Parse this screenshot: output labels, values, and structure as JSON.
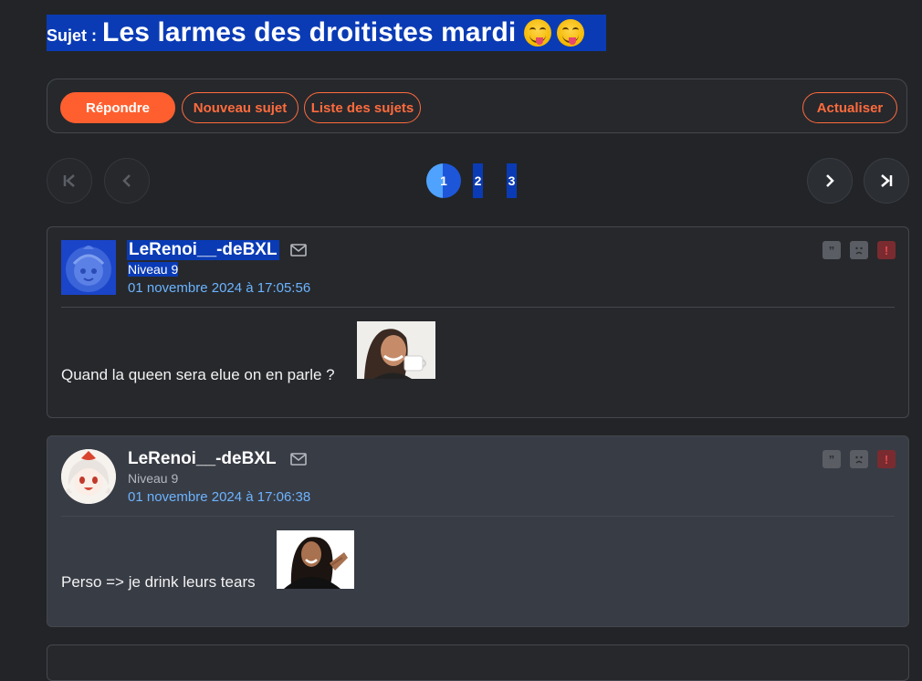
{
  "topic": {
    "prefix": "Sujet :",
    "title": "Les larmes des droitistes mardi"
  },
  "toolbar": {
    "reply_label": "Répondre",
    "new_topic_label": "Nouveau sujet",
    "topic_list_label": "Liste des sujets",
    "refresh_label": "Actualiser"
  },
  "pagination": {
    "pages": [
      "1",
      "2",
      "3"
    ],
    "current": "1"
  },
  "posts": [
    {
      "author": "LeRenoi__-deBXL",
      "level": "Niveau 9",
      "date": "01 novembre 2024 à 17:05:56",
      "message": "Quand la queen sera elue on en parle ?"
    },
    {
      "author": "LeRenoi__-deBXL",
      "level": "Niveau 9",
      "date": "01 novembre 2024 à 17:06:38",
      "message": "Perso => je drink leurs tears"
    }
  ],
  "icons": {
    "first": "first-page-icon",
    "prev": "chevron-left-icon",
    "next": "chevron-right-icon",
    "last": "last-page-icon",
    "mail": "mail-icon",
    "quote": "quote-icon",
    "sad": "sad-face-icon",
    "report": "exclamation-icon",
    "emoji": "face-with-tongue-emoji"
  },
  "colors": {
    "accent": "#ff5f2e",
    "link": "#6cb4ff",
    "selection": "#0a3bb5",
    "background": "#222427"
  }
}
